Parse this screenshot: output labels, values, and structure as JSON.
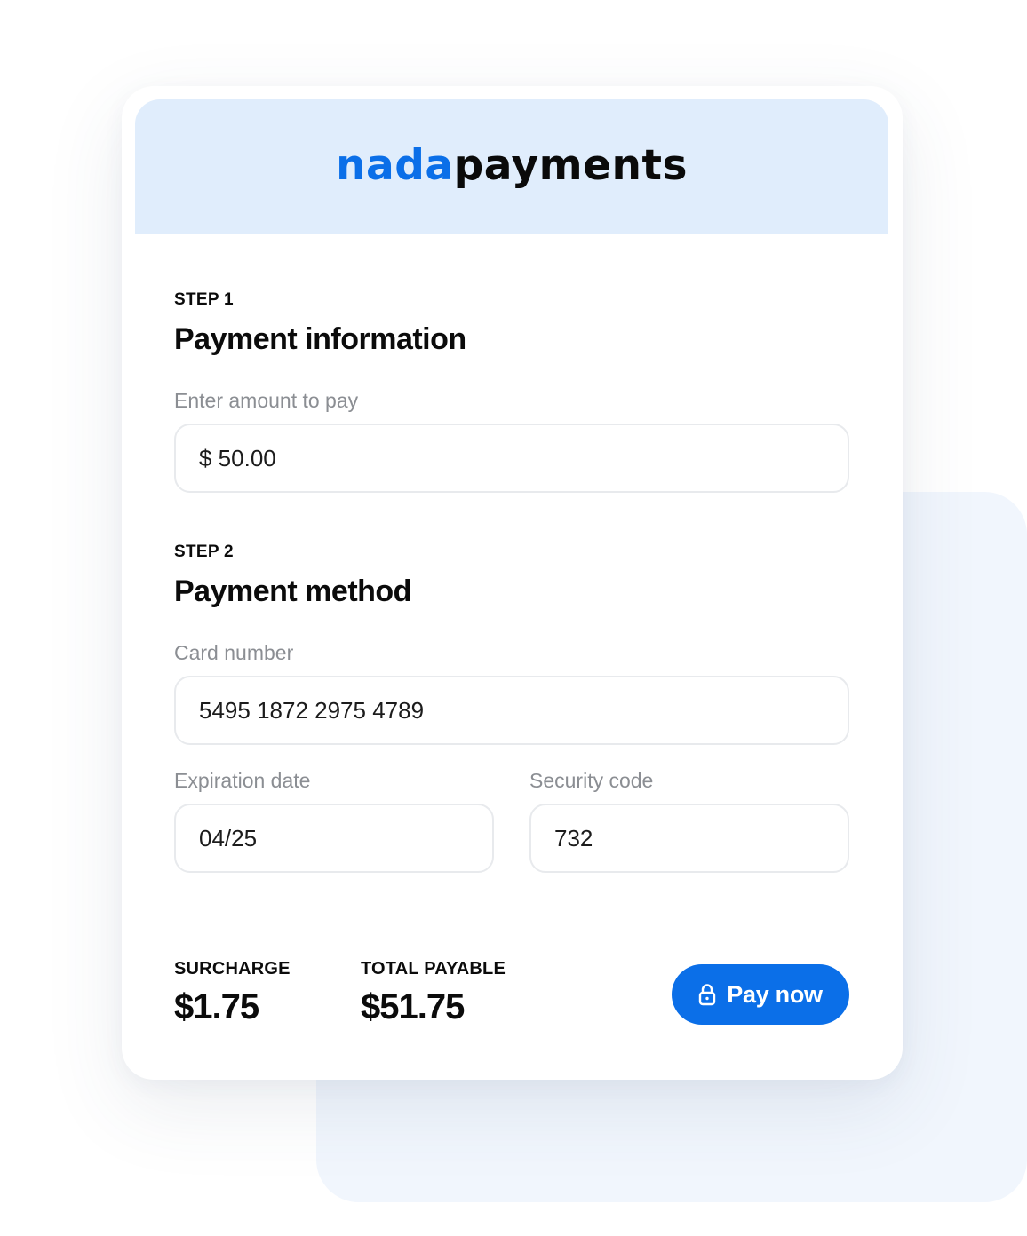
{
  "brand": {
    "name_part1": "nada",
    "name_part2": "payments",
    "accent_color": "#0b6fe8",
    "header_bg": "#e0edfc"
  },
  "step1": {
    "step_label": "STEP 1",
    "title": "Payment information",
    "amount_label": "Enter amount to pay",
    "amount_value": "$ 50.00"
  },
  "step2": {
    "step_label": "STEP 2",
    "title": "Payment method",
    "card_number_label": "Card number",
    "card_number_value": "5495 1872 2975 4789",
    "expiration_label": "Expiration date",
    "expiration_value": "04/25",
    "security_label": "Security code",
    "security_value": "732"
  },
  "summary": {
    "surcharge_label": "SURCHARGE",
    "surcharge_value": "$1.75",
    "total_label": "TOTAL PAYABLE",
    "total_value": "$51.75"
  },
  "pay_button": {
    "label": "Pay now",
    "icon": "lock-icon"
  }
}
